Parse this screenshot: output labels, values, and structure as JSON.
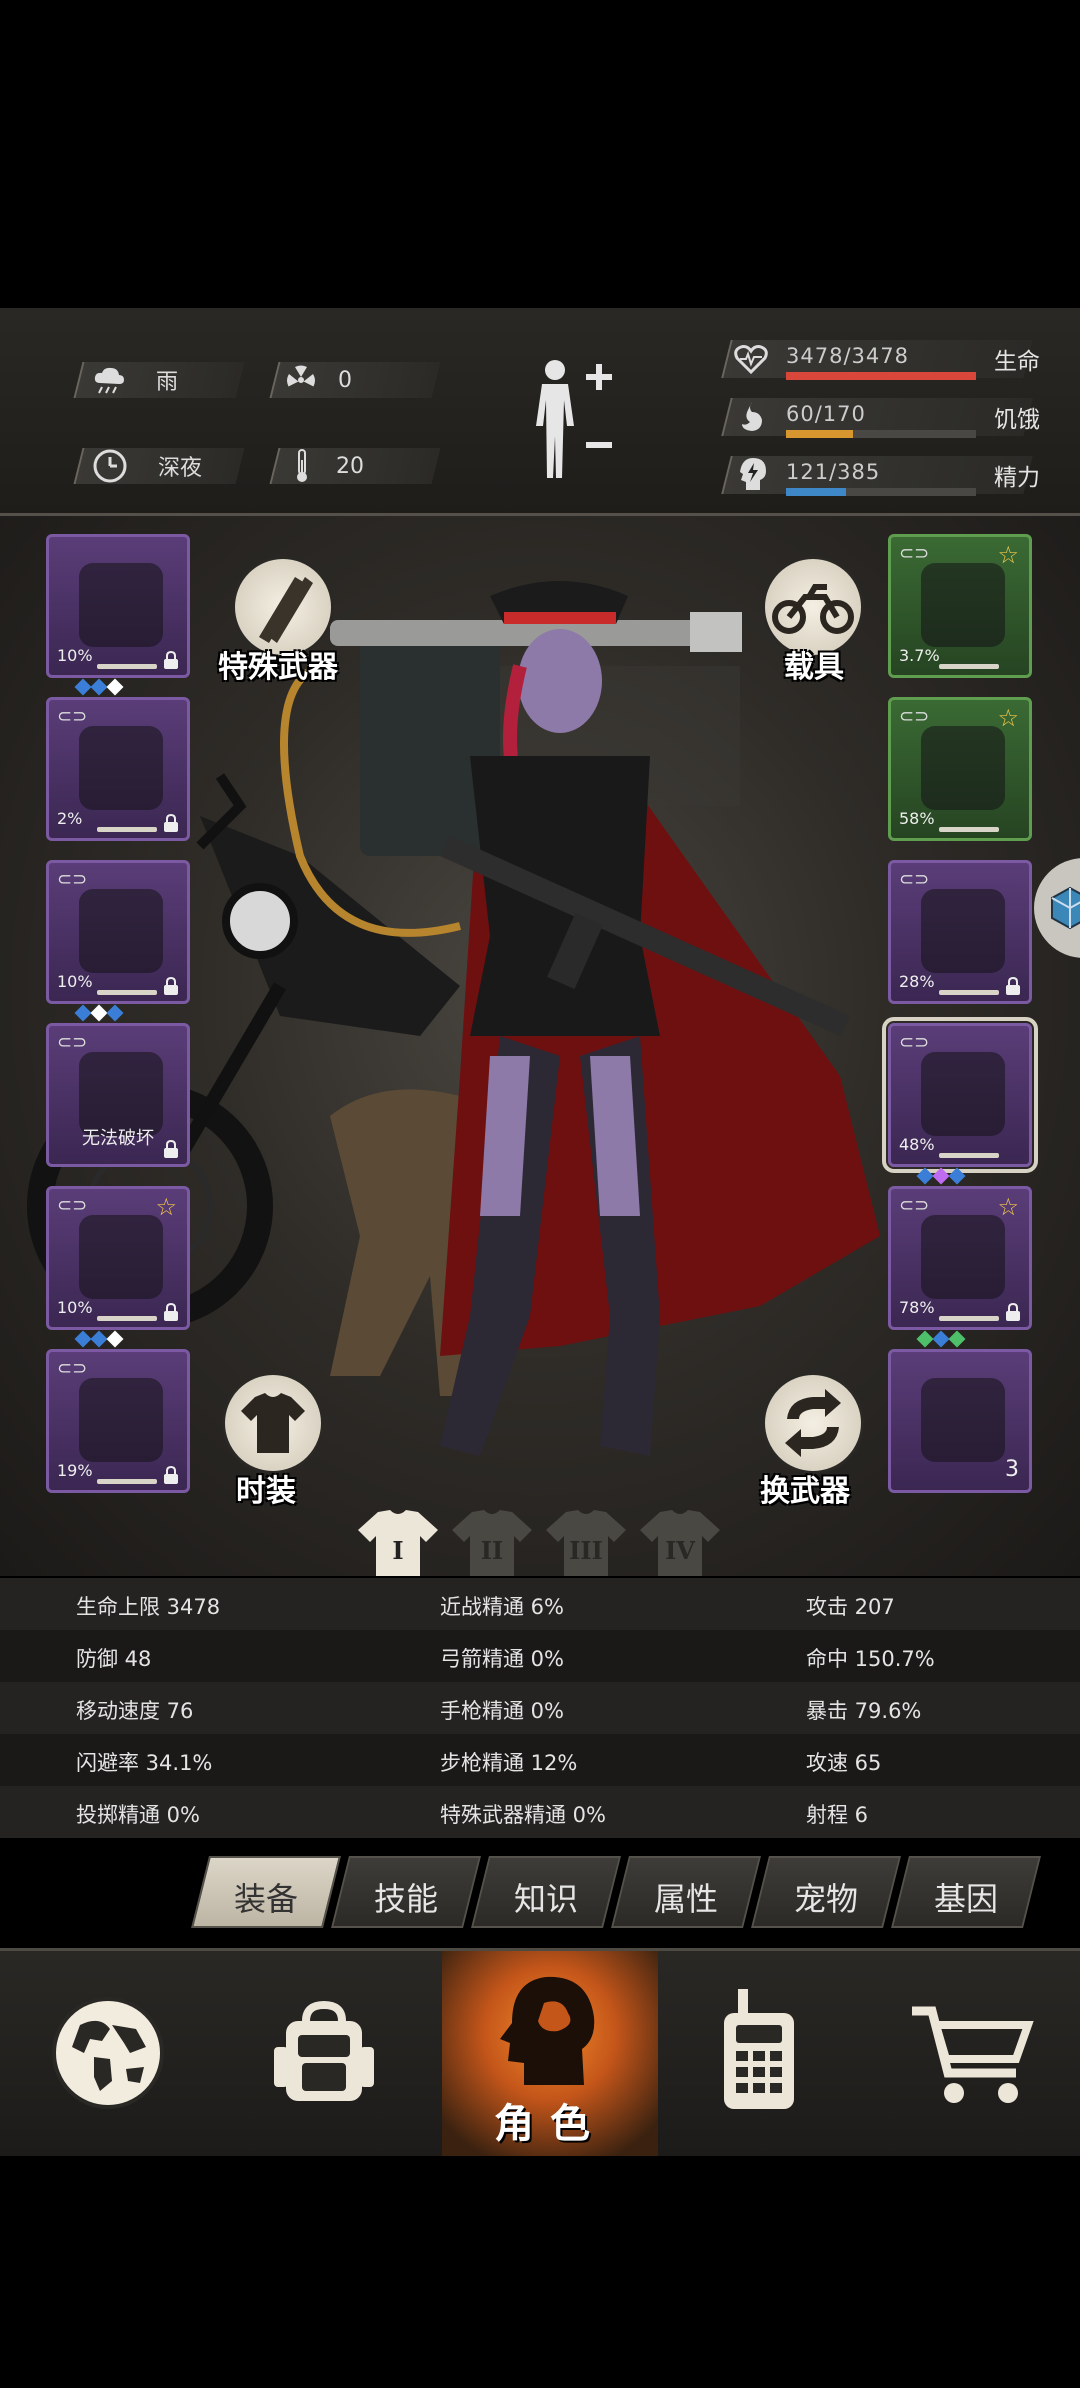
{
  "status": {
    "weather": {
      "icon": "rain-cloud-icon",
      "label": "雨"
    },
    "radiation": {
      "icon": "radiation-icon",
      "value": "0"
    },
    "time_of_day": {
      "icon": "clock-icon",
      "label": "深夜"
    },
    "temperature": {
      "icon": "thermometer-icon",
      "value": "20"
    },
    "vitals": [
      {
        "name": "health",
        "icon": "heart-icon",
        "text": "3478/3478",
        "label": "生命",
        "fill": 1.0,
        "color": "#d9473a"
      },
      {
        "name": "hunger",
        "icon": "stomach-icon",
        "text": "60/170",
        "label": "饥饿",
        "fill": 0.353,
        "color": "#d8962e"
      },
      {
        "name": "energy",
        "icon": "energy-head-icon",
        "text": "121/385",
        "label": "精力",
        "fill": 0.314,
        "color": "#3f88c8"
      }
    ]
  },
  "left_slots": [
    {
      "name": "helmet",
      "icon": "police-helmet-icon",
      "pct": "10%",
      "gems": [
        "#3b7ed8",
        "#3b7ed8",
        "#ffffff"
      ],
      "lock": true
    },
    {
      "name": "shirt",
      "icon": "shirt-icon",
      "pct": "2%",
      "gems": [],
      "lock": true,
      "link": true
    },
    {
      "name": "jacket",
      "icon": "jacket-icon",
      "pct": "10%",
      "gems": [
        "#3b7ed8",
        "#ffffff",
        "#3b7ed8"
      ],
      "lock": true,
      "link": true
    },
    {
      "name": "backpack",
      "icon": "backpack-icon",
      "message": "无法破坏",
      "gems": [],
      "lock": true,
      "link": true
    },
    {
      "name": "pants",
      "icon": "pants-icon",
      "pct": "10%",
      "gems": [
        "#3b7ed8",
        "#3b7ed8",
        "#ffffff"
      ],
      "lock": true,
      "link": true,
      "star": true
    },
    {
      "name": "boots",
      "icon": "boots-icon",
      "pct": "19%",
      "gems": [],
      "lock": true,
      "link": true
    }
  ],
  "right_slots": [
    {
      "name": "glasses",
      "icon": "glasses-icon",
      "pct": "3.7%",
      "gems": [],
      "green": true,
      "link": true,
      "star": true
    },
    {
      "name": "mask",
      "icon": "gas-mask-icon",
      "pct": "58%",
      "gems": [],
      "green": true,
      "link": true,
      "star": true
    },
    {
      "name": "vest",
      "icon": "tactical-vest-icon",
      "pct": "28%",
      "gems": [],
      "lock": true,
      "link": true
    },
    {
      "name": "rifle",
      "icon": "assault-rifle-icon",
      "pct": "48%",
      "gems": [
        "#3b7ed8",
        "#c06cf0",
        "#3b7ed8"
      ],
      "link": true,
      "selected": true
    },
    {
      "name": "sword",
      "icon": "katana-icon",
      "pct": "78%",
      "gems": [
        "#4fc06a",
        "#3b7ed8",
        "#4fc06a"
      ],
      "lock": true,
      "link": true,
      "star": true
    },
    {
      "name": "molotov",
      "icon": "molotov-icon",
      "qty": "3",
      "gems": []
    }
  ],
  "buttons": {
    "special_weapon": {
      "icon": "special-weapon-icon",
      "label": "特殊武器"
    },
    "vehicle": {
      "icon": "motorcycle-icon",
      "label": "载具"
    },
    "fashion": {
      "icon": "tshirt-icon",
      "label": "时装"
    },
    "swap_weapon": {
      "icon": "swap-icon",
      "label": "换武器"
    }
  },
  "outfit_tabs": [
    "I",
    "II",
    "III",
    "IV"
  ],
  "stats": [
    [
      "生命上限 3478",
      "近战精通 6%",
      "攻击 207"
    ],
    [
      "防御 48",
      "弓箭精通 0%",
      "命中 150.7%"
    ],
    [
      "移动速度 76",
      "手枪精通 0%",
      "暴击 79.6%"
    ],
    [
      "闪避率 34.1%",
      "步枪精通 12%",
      "攻速 65"
    ],
    [
      "投掷精通 0%",
      "特殊武器精通 0%",
      "射程 6"
    ]
  ],
  "category_tabs": [
    "装备",
    "技能",
    "知识",
    "属性",
    "宠物",
    "基因"
  ],
  "bottom_nav": [
    {
      "name": "world",
      "icon": "globe-icon"
    },
    {
      "name": "inventory",
      "icon": "backpack-icon"
    },
    {
      "name": "character",
      "icon": "character-head-icon",
      "label": "角色"
    },
    {
      "name": "radio",
      "icon": "walkie-talkie-icon"
    },
    {
      "name": "shop",
      "icon": "shopping-cart-icon"
    }
  ]
}
